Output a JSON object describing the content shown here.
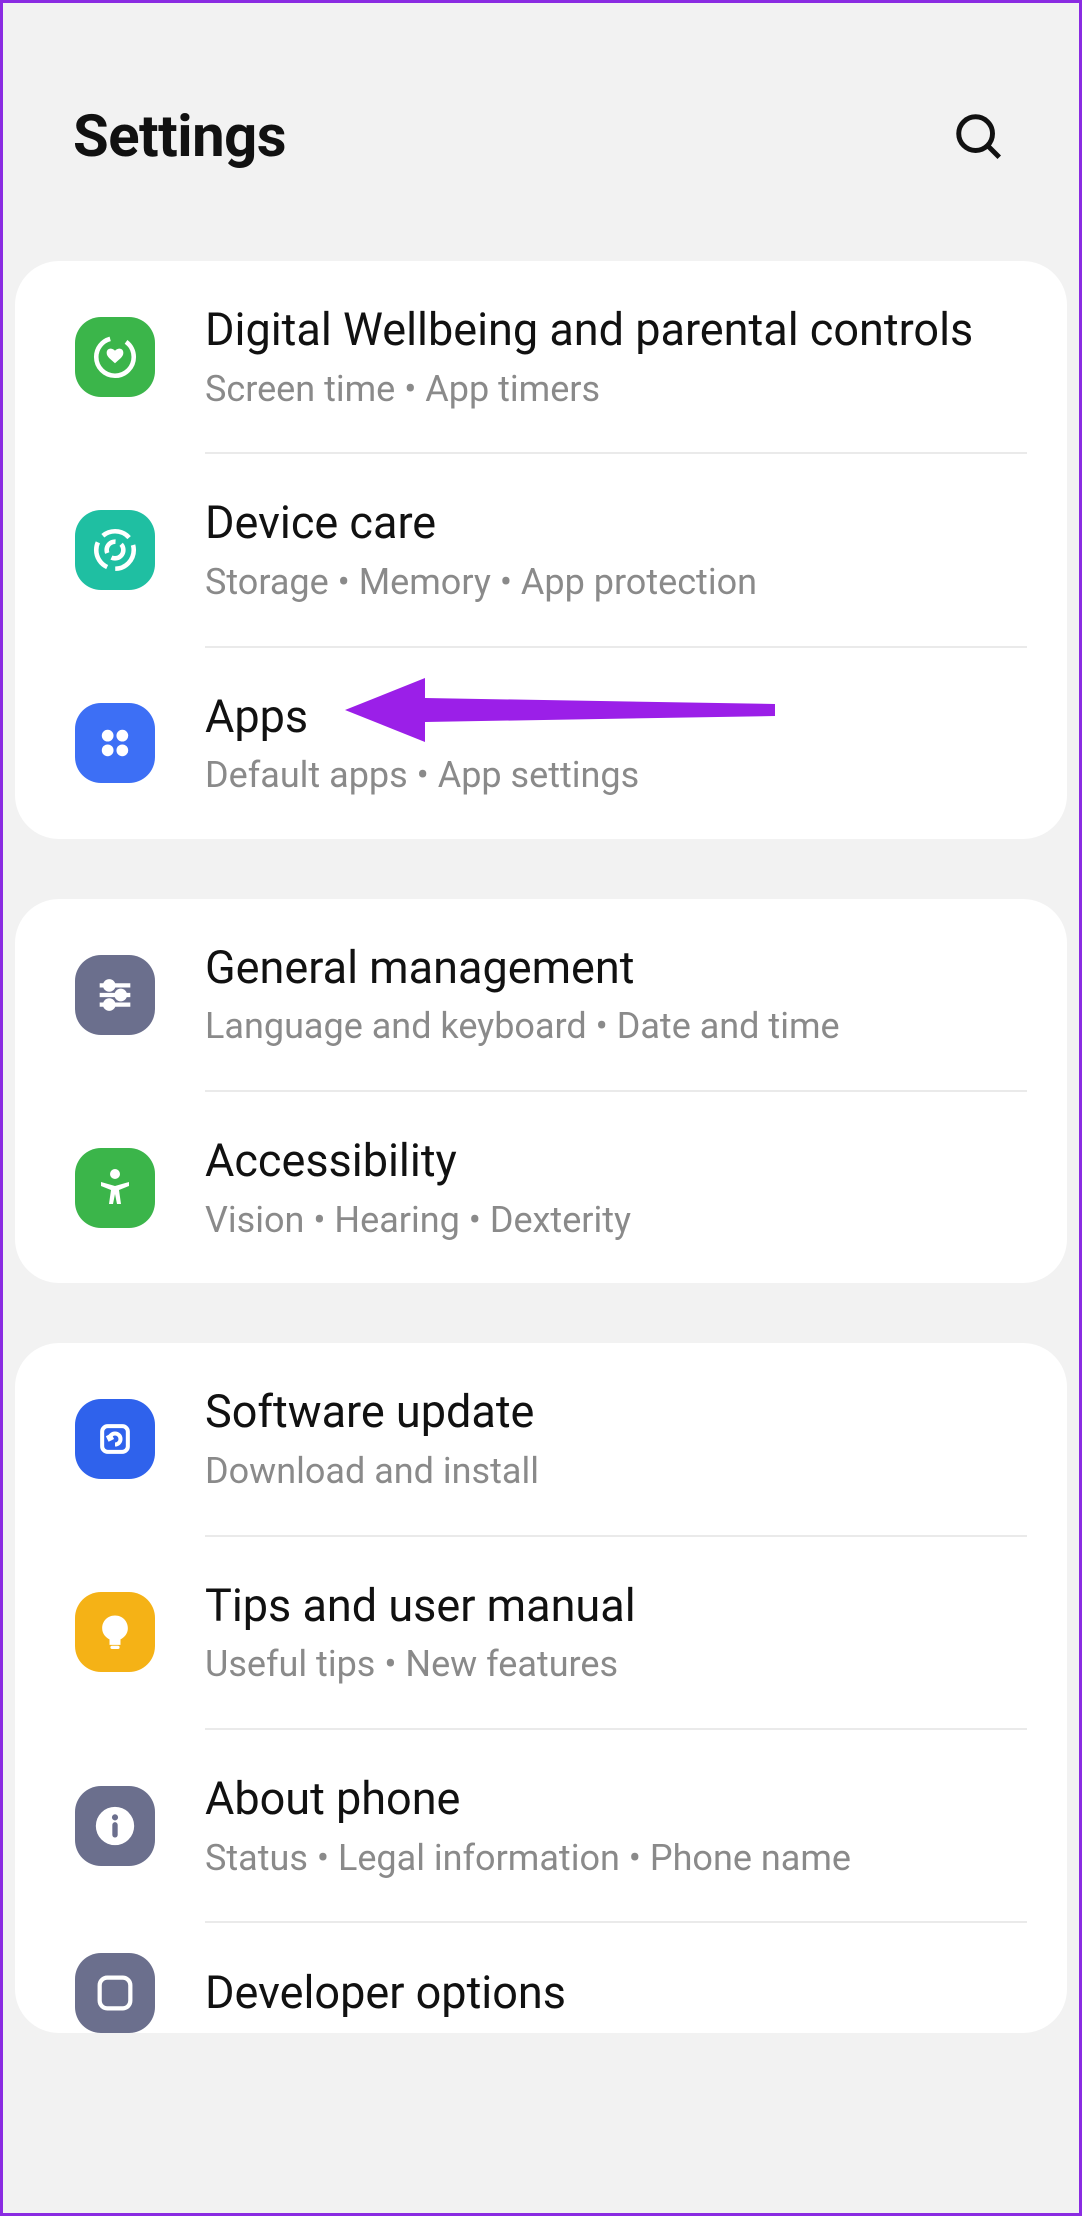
{
  "header": {
    "title": "Settings"
  },
  "icons": {
    "search": "search-icon",
    "wellbeing": "wellbeing-heart-icon",
    "devicecare": "device-care-icon",
    "apps": "apps-grid-icon",
    "general": "sliders-icon",
    "accessibility": "accessibility-person-icon",
    "software": "software-update-icon",
    "tips": "tips-bulb-icon",
    "about": "info-icon",
    "developer": "developer-icon"
  },
  "groups": [
    {
      "items": [
        {
          "id": "wellbeing",
          "title": "Digital Wellbeing and parental controls",
          "subtitle": "Screen time  •  App timers",
          "color": "ic-green"
        },
        {
          "id": "devicecare",
          "title": "Device care",
          "subtitle": "Storage  •  Memory  •  App protection",
          "color": "ic-teal"
        },
        {
          "id": "apps",
          "title": "Apps",
          "subtitle": "Default apps  •  App settings",
          "color": "ic-blue",
          "highlighted": true
        }
      ]
    },
    {
      "items": [
        {
          "id": "general",
          "title": "General management",
          "subtitle": "Language and keyboard  •  Date and time",
          "color": "ic-slate"
        },
        {
          "id": "accessibility",
          "title": "Accessibility",
          "subtitle": "Vision  •  Hearing  •  Dexterity",
          "color": "ic-green2"
        }
      ]
    },
    {
      "items": [
        {
          "id": "software",
          "title": "Software update",
          "subtitle": "Download and install",
          "color": "ic-blue2"
        },
        {
          "id": "tips",
          "title": "Tips and user manual",
          "subtitle": "Useful tips  •  New features",
          "color": "ic-orange"
        },
        {
          "id": "about",
          "title": "About phone",
          "subtitle": "Status  •  Legal information  •  Phone name",
          "color": "ic-slate2"
        }
      ]
    }
  ],
  "partial_row": {
    "id": "developer",
    "title": "Developer options",
    "color": "ic-slate"
  },
  "annotation": {
    "arrow_color": "#9b1fe8",
    "target": "apps"
  }
}
